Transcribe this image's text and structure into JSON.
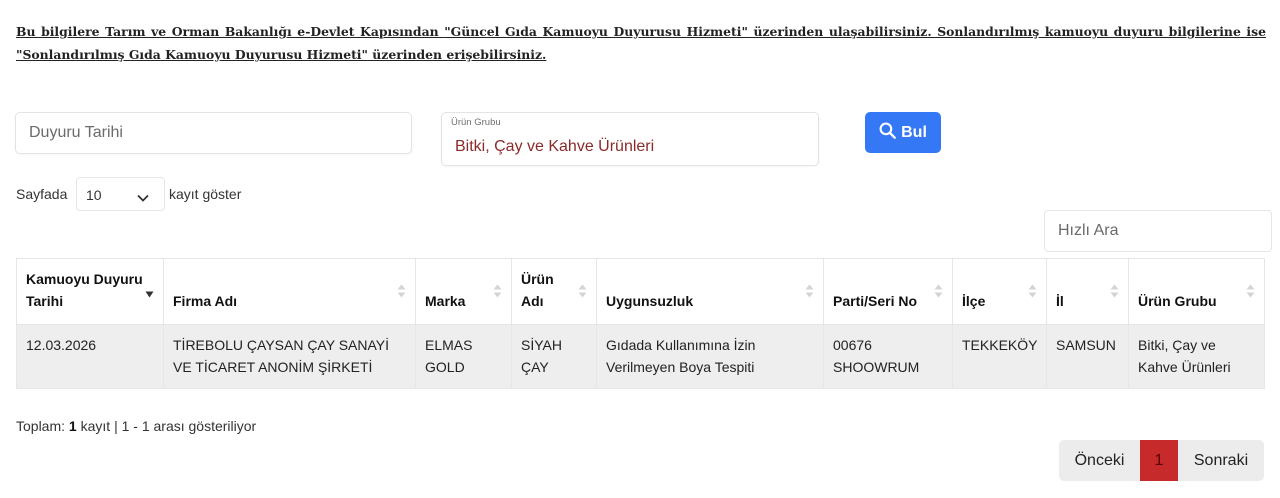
{
  "notice": {
    "part1": "Bu bilgilere Tarım ve Orman Bakanlığı e-Devlet Kapısından ",
    "link1": "\"Güncel Gıda Kamuoyu Duyurusu Hizmeti\"",
    "part2": " üzerinden ulaşabilirsiniz. Sonlandırılmış kamuoyu duyuru bilgilerine ise ",
    "link2": "\"Sonlandırılmış Gıda Kamuoyu Duyurusu Hizmeti\"",
    "part3": " üzerinden erişebilirsiniz."
  },
  "filters": {
    "date_placeholder": "Duyuru Tarihi",
    "group_label": "Ürün Grubu",
    "group_value": "Bitki, Çay ve Kahve Ürünleri",
    "search_label": "Bul"
  },
  "page_length": {
    "before": "Sayfada",
    "value": "10",
    "after": "kayıt göster"
  },
  "quick_search": {
    "placeholder": "Hızlı Ara"
  },
  "table": {
    "headers": [
      "Kamuoyu Duyuru Tarihi",
      "Firma Adı",
      "Marka",
      "Ürün Adı",
      "Uygunsuzluk",
      "Parti/Seri No",
      "İlçe",
      "İl",
      "Ürün Grubu"
    ],
    "rows": [
      [
        "12.03.2026",
        "TİREBOLU ÇAYSAN ÇAY SANAYİ VE TİCARET ANONİM ŞİRKETİ",
        "ELMAS GOLD",
        "SİYAH ÇAY",
        "Gıdada Kullanımına İzin Verilmeyen Boya Tespiti",
        "00676 SHOOWRUM",
        "TEKKEKÖY",
        "SAMSUN",
        "Bitki, Çay ve Kahve Ürünleri"
      ]
    ]
  },
  "summary": {
    "label": "Toplam:",
    "count": "1",
    "rest": "kayıt | 1 - 1 arası gösteriliyor"
  },
  "pagination": {
    "prev": "Önceki",
    "current": "1",
    "next": "Sonraki"
  },
  "colors": {
    "primary_button": "#3478f6",
    "active_page": "#c62a2a",
    "row_background": "#eeeeee",
    "selected_value_text": "#8b2a2a"
  }
}
